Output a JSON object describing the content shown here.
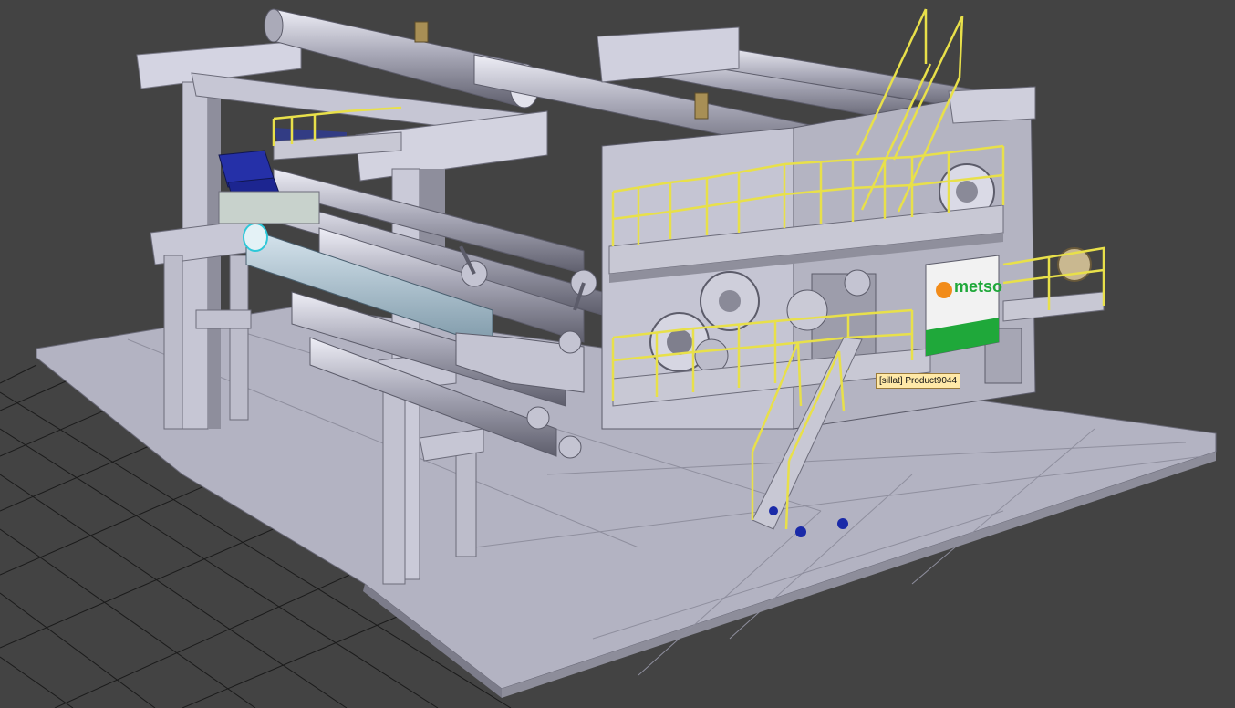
{
  "viewport": {
    "background": "#434343",
    "grid_color": "#1a1a1a",
    "model_color": "#b9b9c8",
    "railing_color": "#e8e04a",
    "logo": {
      "text": "metso",
      "brand_color": "#1fa83a",
      "mark_color": "#f28c1a"
    }
  },
  "tooltip": {
    "text": "[sillat] Product9044"
  }
}
